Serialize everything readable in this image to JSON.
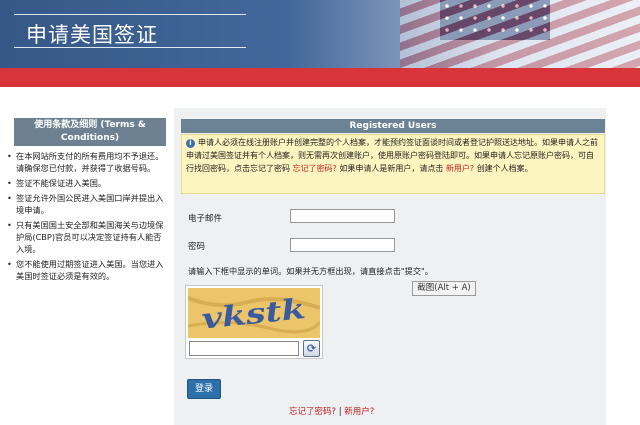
{
  "header": {
    "title": "申请美国签证"
  },
  "terms": {
    "heading_line1": "使用条款及细则 (Terms &",
    "heading_line2": "Conditions)",
    "items": [
      "在本网站所支付的所有费用均不予退还。请确保您已付款，并获得了收据号码。",
      "签证不能保证进入美国。",
      "签证允许外国公民进入美国口岸并提出入境申请。",
      "只有美国国土安全部和美国海关与边境保护局(CBP)官员可以决定签证持有人能否入境。",
      "您不能使用过期签证进入美国。当您进入美国时签证必须是有效的。"
    ]
  },
  "registered": {
    "heading": "Registered Users",
    "notice_text_1": "申请人必须在线注册账户并创建完整的个人档案，才能预约签证面谈时间或者登记护照送达地址。如果申请人之前申请过美国签证并有个人档案，则无需再次创建账户，使用原账户密码登陆即可。如果申请人忘记原账户密码，可自行找回密码，点击忘记了密码",
    "forgot_link": "忘记了密码?",
    "notice_text_2": "如果申请人是新用户，请点击",
    "new_user_link": "新用户?",
    "notice_text_3": "创建个人档案。"
  },
  "form": {
    "email_label": "电子邮件",
    "email_value": "",
    "password_label": "密码",
    "password_value": "",
    "captcha_hint": "请输入下框中显示的单词。如果并无方框出现，请直接点击\"提交\"。",
    "captcha_word": "vkstk",
    "captcha_value": "",
    "login_label": "登录"
  },
  "tooltip": {
    "text": "截图(Alt + A)"
  },
  "footer": {
    "forgot_label": "忘记了密码?",
    "separator": "|",
    "new_user_label": "新用户?"
  },
  "icons": {
    "info": "info-icon",
    "refresh": "refresh-icon"
  },
  "colors": {
    "header_blue": "#365888",
    "red_bar": "#d8353a",
    "section_head": "#6b8395",
    "notice_bg": "#fdf5bf",
    "button_blue": "#2d6fa8",
    "link_red": "#c02020"
  }
}
